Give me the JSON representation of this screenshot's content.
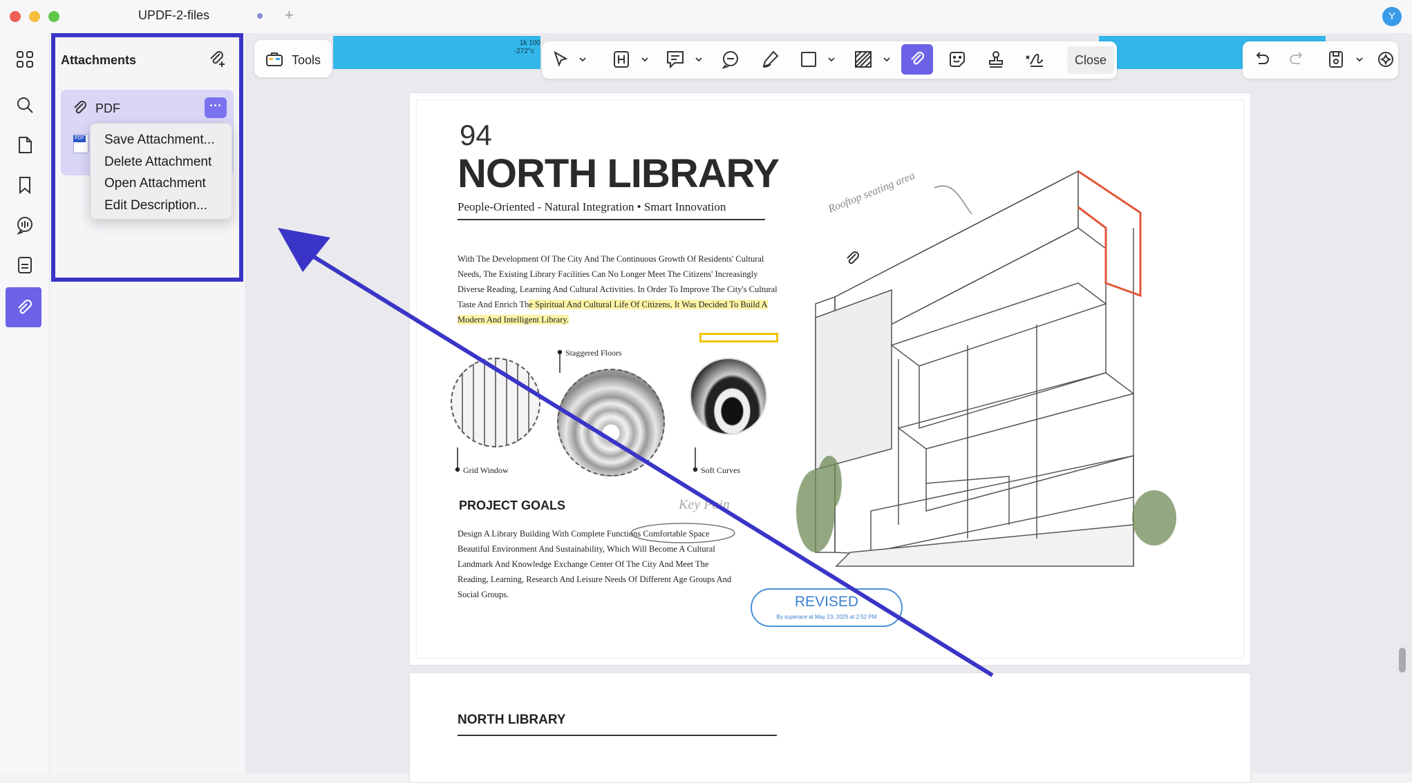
{
  "window": {
    "title": "UPDF-2-files",
    "new_tab": "+",
    "avatar_initial": "Y",
    "traffic_colors": [
      "#ee5f57",
      "#f6bd3f",
      "#5fc84a"
    ]
  },
  "leftbar": {
    "items": [
      {
        "name": "thumbnails",
        "icon": "grid-icon"
      },
      {
        "name": "search",
        "icon": "search-icon"
      },
      {
        "name": "pages",
        "icon": "page-icon"
      },
      {
        "name": "bookmarks",
        "icon": "bookmark-icon"
      },
      {
        "name": "comments",
        "icon": "comment-icon"
      },
      {
        "name": "document",
        "icon": "document-icon"
      },
      {
        "name": "attachments",
        "icon": "paperclip-icon",
        "active": true
      }
    ]
  },
  "panel": {
    "title": "Attachments",
    "attachment": {
      "label": "PDF",
      "more": "···",
      "file_tag": "PDF"
    },
    "context_menu": [
      "Save Attachment...",
      "Delete Attachment",
      "Open Attachment",
      "Edit Description..."
    ]
  },
  "toolbar": {
    "tools_label": "Tools",
    "close_label": "Close",
    "strip_text_1": "1k 100",
    "strip_text_2": "-272°c",
    "accent": "#6b62e8"
  },
  "document": {
    "page_number": "94",
    "title": "NORTH LIBRARY",
    "subtitle": "People-Oriented - Natural Integration • Smart Innovation",
    "body_plain": "With The Development Of The City And The Continuous Growth Of Residents' Cultural Needs, The Existing Library Facilities Can No Longer Meet The Citizens' Increasingly Diverse Reading, Learning And Cultural Activities. In Order To Improve The City's Cultural Taste And Enrich Th",
    "body_highlight": "e Spiritual And Cultural Life Of Citizens, It Was Decided To Build A Modern And Intelligent Library.",
    "captions": {
      "staggered": "Staggered Floors",
      "grid": "Grid Window",
      "soft": "Soft Curves"
    },
    "annotation_rooftop": "Rooftop seating area",
    "goals_title": "PROJECT GOALS",
    "goals_body": "Design A Library Building With Complete Functions Comfortable Space Beautiful Environment And Sustainability, Which Will Become A Cultural Landmark And Knowledge Exchange Center Of The City And Meet The Reading, Learning, Research And Leisure Needs Of Different Age Groups And Social Groups.",
    "keypoint": "Key Poin",
    "stamp_title": "REVISED",
    "stamp_sub": "By superace at May 23, 2025 at 2:52 PM",
    "page2_title": "NORTH LIBRARY"
  },
  "colors": {
    "outline": "#3a35c6",
    "arrow": "#3a35c6",
    "highlight": "#fdf3a6",
    "stamp": "#3a7fce"
  }
}
